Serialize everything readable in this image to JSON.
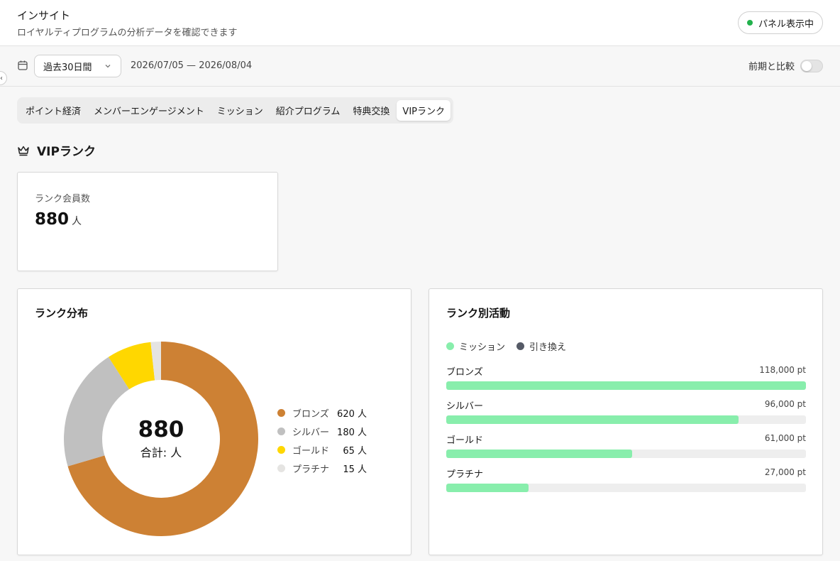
{
  "header": {
    "title": "インサイト",
    "subtitle": "ロイヤルティプログラムの分析データを確認できます",
    "panel_button": "パネル表示中",
    "panel_status_color": "#22b14c"
  },
  "toolbar": {
    "period_select": "過去30日間",
    "date_range": "2026/07/05 — 2026/08/04",
    "compare_label": "前期と比較",
    "compare_enabled": false
  },
  "tabs": [
    {
      "label": "ポイント経済",
      "active": false
    },
    {
      "label": "メンバーエンゲージメント",
      "active": false
    },
    {
      "label": "ミッション",
      "active": false
    },
    {
      "label": "紹介プログラム",
      "active": false
    },
    {
      "label": "特典交換",
      "active": false
    },
    {
      "label": "VIPランク",
      "active": true
    }
  ],
  "section": {
    "title": "VIPランク",
    "icon": "crown-icon"
  },
  "member_card": {
    "label": "ランク会員数",
    "value": "880",
    "unit": "人"
  },
  "distribution": {
    "title": "ランク分布",
    "total": "880",
    "total_label": "合計: 人",
    "legend": [
      {
        "name": "ブロンズ",
        "count": "620 人"
      },
      {
        "name": "シルバー",
        "count": "180 人"
      },
      {
        "name": "ゴールド",
        "count": "65 人"
      },
      {
        "name": "プラチナ",
        "count": "15 人"
      }
    ]
  },
  "activity": {
    "title": "ランク別活動",
    "legend": [
      {
        "name": "ミッション",
        "color": "#88eeac"
      },
      {
        "name": "引き換え",
        "color": "#555a66"
      }
    ],
    "rows": [
      {
        "name": "ブロンズ",
        "value": "118,000 pt"
      },
      {
        "name": "シルバー",
        "value": "96,000 pt"
      },
      {
        "name": "ゴールド",
        "value": "61,000 pt"
      },
      {
        "name": "プラチナ",
        "value": "27,000 pt"
      }
    ]
  },
  "chart_data": [
    {
      "type": "pie",
      "categories": [
        "ブロンズ",
        "シルバー",
        "ゴールド",
        "プラチナ"
      ],
      "values": [
        620,
        180,
        65,
        15
      ],
      "colors": [
        "#cd8134",
        "#c0c0c0",
        "#ffd700",
        "#e5e4e2"
      ],
      "title": "ランク分布",
      "donut": true,
      "legend": "right"
    },
    {
      "type": "bar",
      "orientation": "horizontal",
      "categories": [
        "ブロンズ",
        "シルバー",
        "ゴールド",
        "プラチナ"
      ],
      "series": [
        {
          "name": "ミッション",
          "values": [
            118000,
            96000,
            61000,
            27000
          ],
          "color": "#88eeac"
        },
        {
          "name": "引き換え",
          "values": [
            0,
            0,
            0,
            0
          ],
          "color": "#555a66"
        }
      ],
      "title": "ランク別活動",
      "xlim": [
        0,
        118000
      ],
      "legend": "top-left"
    }
  ]
}
